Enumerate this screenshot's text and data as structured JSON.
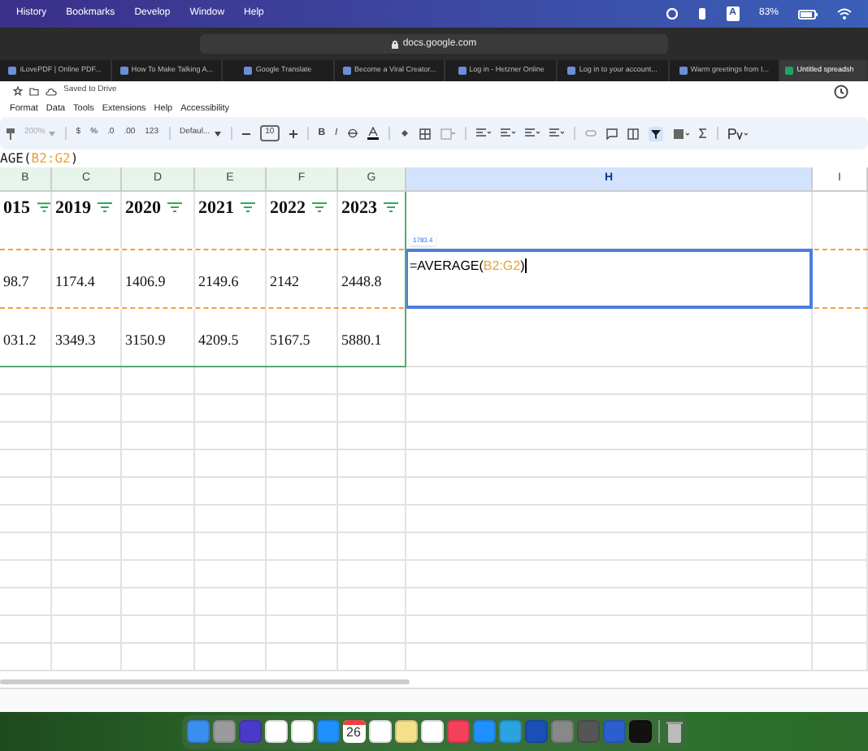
{
  "menu_bar": {
    "items": [
      "History",
      "Bookmarks",
      "Develop",
      "Window",
      "Help"
    ],
    "input_badge": "A",
    "battery": "83%"
  },
  "address_bar": {
    "url": "docs.google.com"
  },
  "browser_tabs": [
    {
      "label": "iLovePDF | Online PDF...",
      "selected": false
    },
    {
      "label": "How To Make Talking A...",
      "selected": false
    },
    {
      "label": "Google Translate",
      "selected": false
    },
    {
      "label": "Become a Viral Creator...",
      "selected": false
    },
    {
      "label": "Log in - Hetzner Online",
      "selected": false
    },
    {
      "label": "Log in to your account...",
      "selected": false
    },
    {
      "label": "Warm greetings from I...",
      "selected": false
    },
    {
      "label": "Untitled spreadsh",
      "selected": true
    }
  ],
  "doc": {
    "save_status": "Saved to Drive",
    "menus": [
      "Format",
      "Data",
      "Tools",
      "Extensions",
      "Help",
      "Accessibility"
    ]
  },
  "toolbar": {
    "zoom": "200%",
    "items": [
      "$",
      "%",
      ".0",
      ".00",
      "123"
    ],
    "font": "Defaul...",
    "font_size": "10",
    "bold": "B",
    "italic": "I"
  },
  "formula_bar": [
    {
      "kind": "plain",
      "text": "AGE("
    },
    {
      "kind": "ref",
      "text": "B2:G2"
    },
    {
      "kind": "plain",
      "text": ")"
    }
  ],
  "sheet": {
    "columns": [
      {
        "label": "B",
        "selected": false
      },
      {
        "label": "C",
        "selected": false
      },
      {
        "label": "D",
        "selected": false
      },
      {
        "label": "E",
        "selected": false
      },
      {
        "label": "F",
        "selected": false
      },
      {
        "label": "G",
        "selected": false
      },
      {
        "label": "H",
        "selected": true
      },
      {
        "label": "I",
        "selected": false
      }
    ],
    "header_row": [
      "015",
      "2019",
      "2020",
      "2021",
      "2022",
      "2023"
    ],
    "rows": [
      [
        "98.7",
        "1174.4",
        "1406.9",
        "2149.6",
        "2142",
        "2448.8"
      ],
      [
        "031.2",
        "3349.3",
        "3150.9",
        "4209.5",
        "5167.5",
        "5880.1"
      ]
    ],
    "result_chip": "1783.4",
    "active_cell": [
      {
        "kind": "plain",
        "text": "=AVERAGE("
      },
      {
        "kind": "ref",
        "text": "B2:G2"
      },
      {
        "kind": "plain",
        "text": ")"
      }
    ]
  },
  "dock": {
    "calendar_day": "26"
  }
}
